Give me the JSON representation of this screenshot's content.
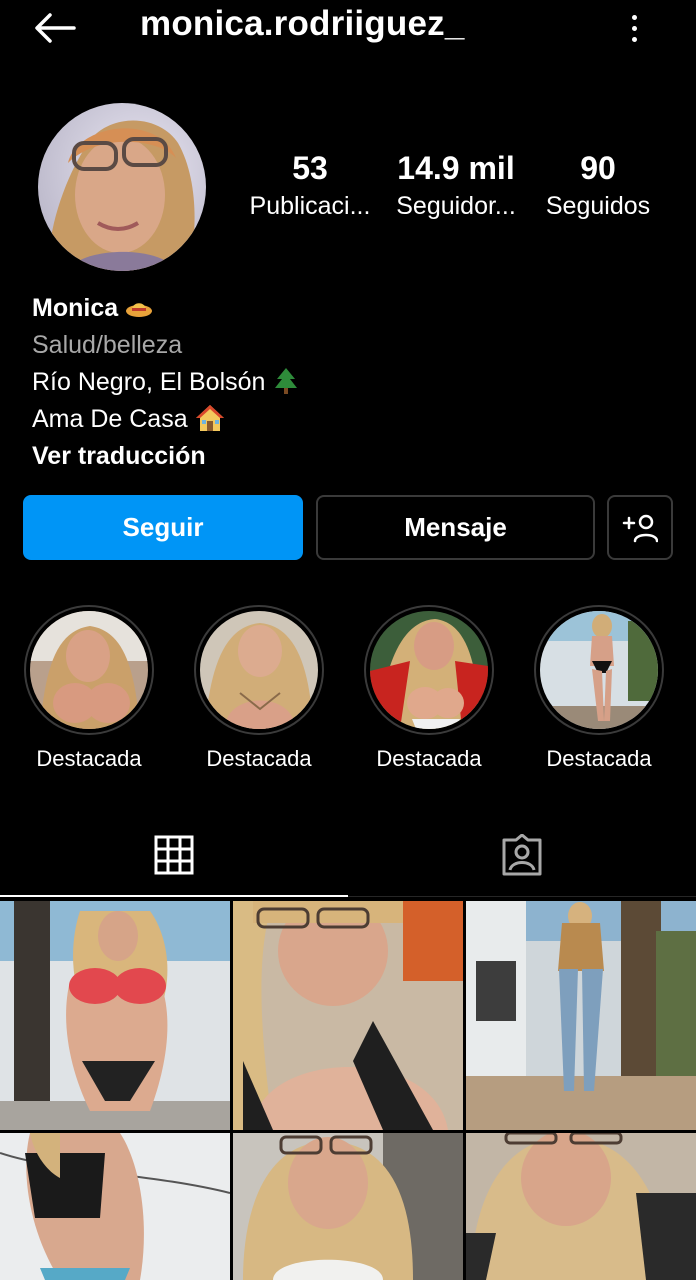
{
  "header": {
    "username": "monica.rodriiguez_",
    "back_icon": "arrow-left-icon",
    "more_icon": "more-vertical-icon"
  },
  "stats": {
    "posts": {
      "value": "53",
      "label": "Publicaci..."
    },
    "followers": {
      "value": "14.9 mil",
      "label": "Seguidor..."
    },
    "following": {
      "value": "90",
      "label": "Seguidos"
    }
  },
  "bio": {
    "name": "Monica",
    "category": "Salud/belleza",
    "location": "Río Negro, El Bolsón",
    "occupation": "Ama De Casa",
    "translate_link": "Ver traducción"
  },
  "buttons": {
    "follow": "Seguir",
    "message": "Mensaje",
    "suggest_icon": "add-user-icon"
  },
  "highlights": [
    {
      "label": "Destacada"
    },
    {
      "label": "Destacada"
    },
    {
      "label": "Destacada"
    },
    {
      "label": "Destacada"
    }
  ],
  "tabs": [
    {
      "icon": "grid-icon",
      "active": true
    },
    {
      "icon": "tagged-user-icon",
      "active": false
    }
  ],
  "colors": {
    "background": "#000000",
    "accent_blue": "#0095f6",
    "secondary_text": "#a8a8a8",
    "border": "#3a3a3a"
  }
}
